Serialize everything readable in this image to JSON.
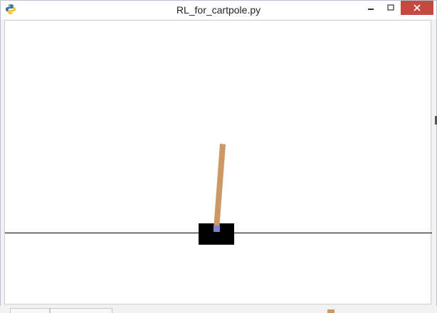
{
  "window": {
    "title": "RL_for_cartpole.py",
    "app_icon": "python-icon"
  },
  "controls": {
    "minimize_icon": "minimize-icon",
    "maximize_icon": "maximize-icon",
    "close_icon": "close-icon"
  },
  "scene": {
    "background": "#ffffff",
    "track_color": "#000000",
    "cart_color": "#000000",
    "pole_color": "#cc9966",
    "axle_color": "#8080cc"
  }
}
